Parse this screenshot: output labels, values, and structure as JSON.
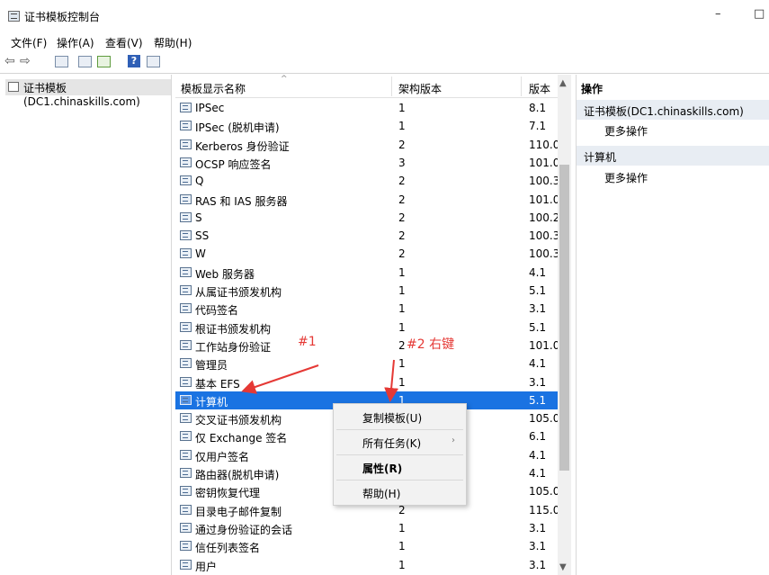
{
  "window": {
    "title": "证书模板控制台",
    "minimize": "–",
    "maximize": "□"
  },
  "menu": [
    "文件(F)",
    "操作(A)",
    "查看(V)",
    "帮助(H)"
  ],
  "tree": {
    "root_label": "证书模板(DC1.chinaskills.com)"
  },
  "list": {
    "headers": {
      "name": "模板显示名称",
      "schema": "架构版本",
      "version": "版本"
    },
    "rows": [
      {
        "name": "IPSec",
        "schema": "1",
        "version": "8.1"
      },
      {
        "name": "IPSec (脱机申请)",
        "schema": "1",
        "version": "7.1"
      },
      {
        "name": "Kerberos 身份验证",
        "schema": "2",
        "version": "110.0"
      },
      {
        "name": "OCSP 响应签名",
        "schema": "3",
        "version": "101.0"
      },
      {
        "name": "Q",
        "schema": "2",
        "version": "100.3"
      },
      {
        "name": "RAS 和 IAS 服务器",
        "schema": "2",
        "version": "101.0"
      },
      {
        "name": "S",
        "schema": "2",
        "version": "100.2"
      },
      {
        "name": "SS",
        "schema": "2",
        "version": "100.3"
      },
      {
        "name": "W",
        "schema": "2",
        "version": "100.3"
      },
      {
        "name": "Web 服务器",
        "schema": "1",
        "version": "4.1"
      },
      {
        "name": "从属证书颁发机构",
        "schema": "1",
        "version": "5.1"
      },
      {
        "name": "代码签名",
        "schema": "1",
        "version": "3.1"
      },
      {
        "name": "根证书颁发机构",
        "schema": "1",
        "version": "5.1"
      },
      {
        "name": "工作站身份验证",
        "schema": "2",
        "version": "101.0"
      },
      {
        "name": "管理员",
        "schema": "1",
        "version": "4.1"
      },
      {
        "name": "基本 EFS",
        "schema": "1",
        "version": "3.1"
      },
      {
        "name": "计算机",
        "schema": "1",
        "version": "5.1",
        "selected": true
      },
      {
        "name": "交叉证书颁发机构",
        "schema": "",
        "version": "105.0"
      },
      {
        "name": "仅 Exchange 签名",
        "schema": "",
        "version": "6.1"
      },
      {
        "name": "仅用户签名",
        "schema": "",
        "version": "4.1"
      },
      {
        "name": "路由器(脱机申请)",
        "schema": "",
        "version": "4.1"
      },
      {
        "name": "密钥恢复代理",
        "schema": "",
        "version": "105.0"
      },
      {
        "name": "目录电子邮件复制",
        "schema": "2",
        "version": "115.0"
      },
      {
        "name": "通过身份验证的会话",
        "schema": "1",
        "version": "3.1"
      },
      {
        "name": "信任列表签名",
        "schema": "1",
        "version": "3.1"
      },
      {
        "name": "用户",
        "schema": "1",
        "version": "3.1"
      }
    ]
  },
  "actions": {
    "header": "操作",
    "section1": "证书模板(DC1.chinaskills.com)",
    "section1_more": "更多操作",
    "section2": "计算机",
    "section2_more": "更多操作"
  },
  "context_menu": {
    "duplicate": "复制模板(U)",
    "all_tasks": "所有任务(K)",
    "properties": "属性(R)",
    "help": "帮助(H)"
  },
  "annotations": {
    "a1": "#1",
    "a2": "#2 右键",
    "color": "#e53935"
  }
}
